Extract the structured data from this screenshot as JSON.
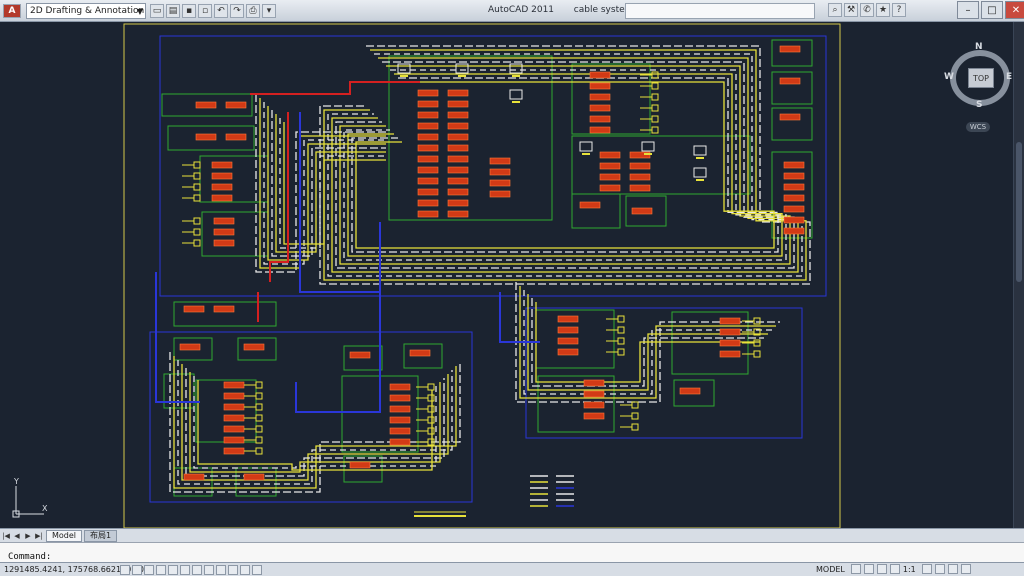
{
  "app": {
    "title": "AutoCAD 2011",
    "file_name": "cable system.dwg",
    "workspace": "2D Drafting & Annotation"
  },
  "viewcube": {
    "face": "TOP",
    "north": "N",
    "south": "S",
    "east": "E",
    "west": "W",
    "ucs_badge": "WCS"
  },
  "ucs_icon": {
    "y_label": "Y",
    "x_label": "X"
  },
  "layout_tabs": [
    {
      "label": "Model",
      "active": true
    },
    {
      "label": "布局1",
      "active": false
    }
  ],
  "command_line": {
    "prompt": "Command:"
  },
  "status_bar": {
    "coordinates": "1291485.4241, 175768.6621, 0.0000",
    "space": "MODEL",
    "annotation_scale": "1:1"
  },
  "colors": {
    "background": "#1b2330",
    "border": "#d4c84a",
    "cable_white": "#e8e8e8",
    "cable_yellow": "#e8e23a",
    "cable_blue": "#2a36d8",
    "cable_red": "#d42020",
    "device_red": "#d23a16",
    "zone_green": "#2fa82f"
  },
  "icons": {
    "help": "question-icon",
    "search": "binoculars-icon",
    "info": "star-icon"
  }
}
